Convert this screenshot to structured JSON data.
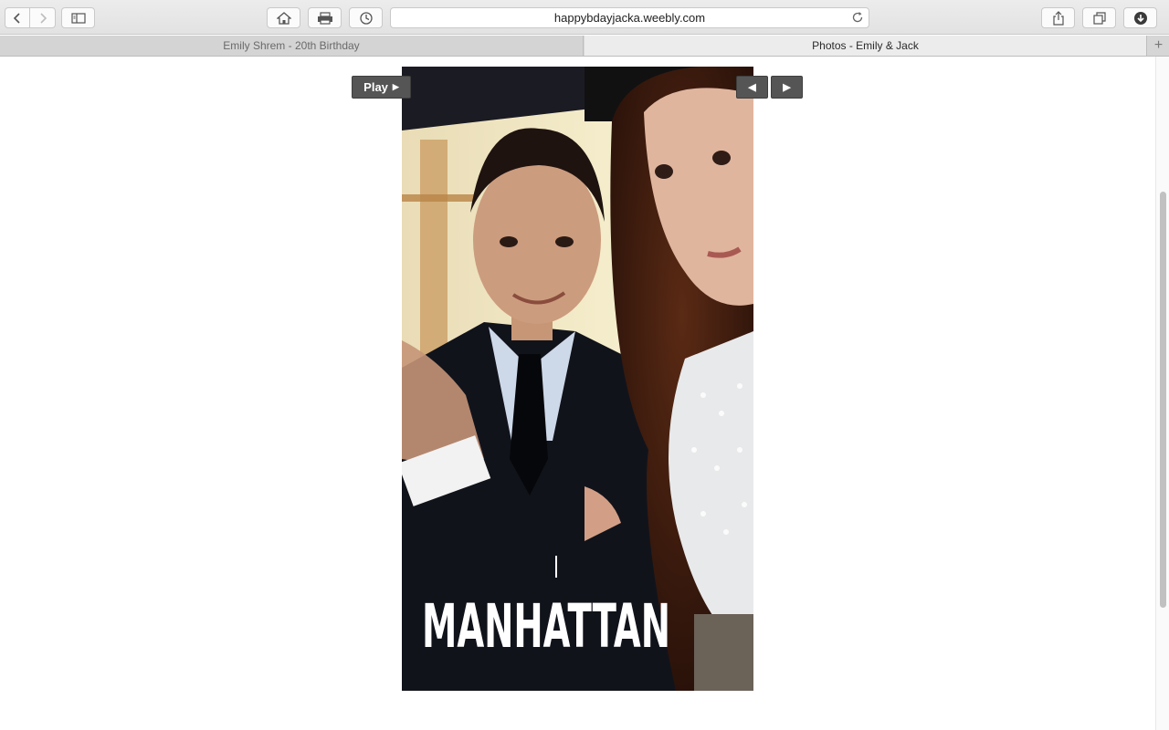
{
  "browser": {
    "url": "happybdayjacka.weebly.com",
    "tabs": [
      {
        "label": "Emily Shrem - 20th Birthday",
        "active": false
      },
      {
        "label": "Photos - Emily & Jack",
        "active": true
      }
    ],
    "new_tab_symbol": "+",
    "toolbar_icons": [
      "back-icon",
      "forward-icon",
      "sidebar-icon",
      "home-icon",
      "print-icon",
      "history-icon",
      "reload-icon",
      "share-icon",
      "tabs-overview-icon",
      "downloads-icon"
    ]
  },
  "slideshow": {
    "play_label": "Play",
    "play_arrow": "▶",
    "prev_symbol": "◀",
    "next_symbol": "▶",
    "photo": {
      "caption_overlay": "MANHATTAN"
    }
  },
  "colors": {
    "control_bg": "#555555",
    "page_bg": "#ffffff",
    "toolbar_bg": "#e6e6e6"
  }
}
